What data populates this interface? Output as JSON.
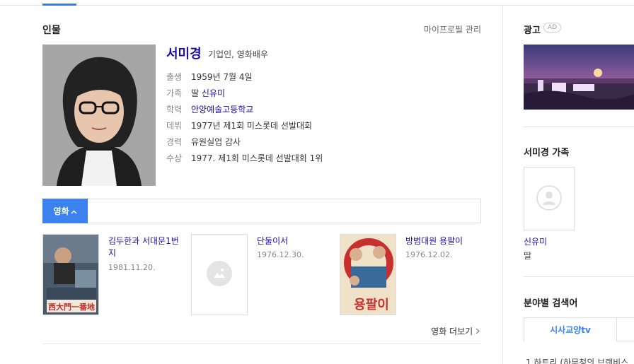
{
  "section": {
    "title": "인물",
    "manage": "마이프로필 관리"
  },
  "person": {
    "name": "서미경",
    "roles": "기업인, 영화배우",
    "info": [
      {
        "key": "출생",
        "value": "1959년 7월 4일",
        "link": false
      },
      {
        "key": "가족",
        "value": "딸 신유미",
        "link": true
      },
      {
        "key": "학력",
        "value": "안양예술고등학교",
        "link": true
      },
      {
        "key": "데뷔",
        "value": "1977년 제1회 미스롯데 선발대회",
        "link": false
      },
      {
        "key": "경력",
        "value": "유원실업 감사",
        "link": false
      },
      {
        "key": "수상",
        "value": "1977. 제1회 미스롯데 선발대회 1위",
        "link": false
      }
    ]
  },
  "tabs": {
    "movie": "영화"
  },
  "movies": [
    {
      "title": "김두한과 서대문1번지",
      "date": "1981.11.20."
    },
    {
      "title": "단둘이서",
      "date": "1976.12.30."
    },
    {
      "title": "방범대원 용팔이",
      "date": "1976.12.02."
    }
  ],
  "more": "영화 더보기",
  "cut_text": "...",
  "right": {
    "ad_title": "광고",
    "ad_badge": "AD",
    "family_title": "서미경 가족",
    "family_name": "신유미",
    "family_rel": "딸",
    "field_title": "분야별 검색어",
    "field_tab": "시사교양tv",
    "field_item": "1  하트리 (하무청의 브랜비스"
  },
  "colors": {
    "accent": "#3b82f0",
    "link": "#1a0dab"
  }
}
